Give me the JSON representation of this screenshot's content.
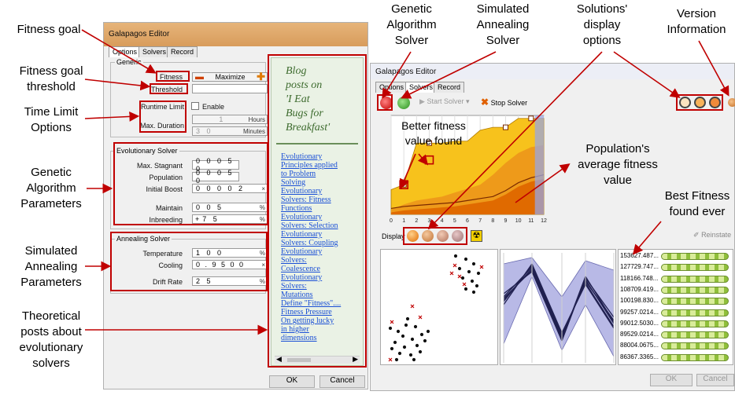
{
  "callouts": {
    "fitness_goal": "Fitness goal",
    "fitness_goal_threshold": [
      "Fitness goal",
      "threshold"
    ],
    "time_limit": [
      "Time Limit",
      "Options"
    ],
    "ga_params": [
      "Genetic",
      "Algorithm",
      "Parameters"
    ],
    "sa_params": [
      "Simulated",
      "Annealing",
      "Parameters"
    ],
    "theory_posts": [
      "Theoretical",
      "posts about",
      "evolutionary",
      "solvers"
    ],
    "ga_solver": [
      "Genetic",
      "Algorithm",
      "Solver"
    ],
    "sa_solver": [
      "Simulated",
      "Annealing",
      "Solver"
    ],
    "display_options": [
      "Solutions'",
      "display",
      "options"
    ],
    "version_info": [
      "Version",
      "Information"
    ],
    "better_fitness": [
      "Better fitness",
      "value found"
    ],
    "population_avg": [
      "Population's",
      "average fitness",
      "value"
    ],
    "best_fitness": [
      "Best Fitness",
      "found ever"
    ]
  },
  "left_editor": {
    "title": "Galapagos Editor",
    "tabs": [
      "Options",
      "Solvers",
      "Record"
    ],
    "generic_group": "Generic",
    "fitness_label": "Fitness",
    "fitness_mode": "Maximize",
    "threshold_label": "Threshold",
    "runtime_limit_label": "Runtime Limit",
    "enable_label": "Enable",
    "hours_value": "1",
    "hours_unit": "Hours",
    "max_duration_label": "Max. Duration",
    "minutes_value": "3 0",
    "minutes_unit": "Minutes",
    "evo_group": "Evolutionary Solver",
    "max_stagnant_label": "Max. Stagnant",
    "max_stagnant_value": "0 0 0 5 0",
    "population_label": "Population",
    "population_value": "0 0 0 5 0",
    "initial_boost_label": "Initial Boost",
    "initial_boost_value": "0 0 0 0 2",
    "initial_boost_unit": "×",
    "maintain_label": "Maintain",
    "maintain_value": "0 0 5",
    "maintain_unit": "%",
    "inbreeding_label": "Inbreeding",
    "inbreeding_sign": "+",
    "inbreeding_value": "7 5",
    "inbreeding_unit": "%",
    "anneal_group": "Annealing Solver",
    "temperature_label": "Temperature",
    "temperature_value": "1 0 0",
    "temperature_unit": "%",
    "cooling_label": "Cooling",
    "cooling_value": "0 . 9 5 0 0",
    "cooling_unit": "×",
    "drift_label": "Drift Rate",
    "drift_value": "2 5",
    "drift_unit": "%",
    "ok": "OK",
    "cancel": "Cancel",
    "blog_title": [
      "Blog",
      "posts on",
      "'I Eat",
      "Bugs for",
      "Breakfast'"
    ],
    "blog_links": [
      "Evolutionary",
      "Principles applied",
      "to Problem",
      "Solving",
      "Evolutionary",
      "Solvers: Fitness",
      "Functions",
      "Evolutionary",
      "Solvers: Selection",
      "Evolutionary",
      "Solvers: Coupling",
      "Evolutionary",
      "Solvers:",
      "Coalescence",
      "Evolutionary",
      "Solvers:",
      "Mutations",
      "Define \"Fitness\"....",
      "Fitness Pressure",
      "On getting lucky",
      "in higher",
      "dimensions"
    ]
  },
  "right_editor": {
    "title": "Galapagos Editor",
    "tabs": [
      "Options",
      "Solvers",
      "Record"
    ],
    "start_solver": "Start Solver",
    "stop_solver": "Stop Solver",
    "display_label": "Display",
    "reinstate": "Reinstate",
    "ok": "OK",
    "cancel": "Cancel",
    "x_ticks": [
      "0",
      "1",
      "2",
      "3",
      "4",
      "5",
      "6",
      "7",
      "8",
      "9",
      "10",
      "11",
      "12"
    ],
    "fitness_values": [
      "153627.487...",
      "127729.747...",
      "118166.748...",
      "108709.419...",
      "100198.830...",
      "99257.0214...",
      "99012.5030...",
      "89529.0214...",
      "88004.0675...",
      "86367.3365..."
    ],
    "colors": {
      "fill": "#f5b800",
      "dark_fill": "#e07800",
      "panel": "#c9cadc"
    }
  },
  "chart_data": {
    "type": "area",
    "title": "",
    "x": [
      0,
      1,
      2,
      3,
      4,
      5,
      6,
      7,
      8,
      9,
      10,
      11,
      12
    ],
    "series": [
      {
        "values": [
          0.25,
          0.3,
          0.72,
          0.72,
          0.72,
          0.74,
          0.74,
          0.85,
          0.88,
          0.88,
          0.97,
          0.97,
          0.97
        ]
      },
      {
        "values": [
          0.05,
          0.1,
          0.14,
          0.16,
          0.18,
          0.22,
          0.26,
          0.3,
          0.4,
          0.52,
          0.62,
          0.68,
          0.7
        ]
      },
      {
        "values": [
          0.02,
          0.04,
          0.05,
          0.06,
          0.07,
          0.08,
          0.1,
          0.12,
          0.14,
          0.2,
          0.28,
          0.33,
          0.36
        ]
      }
    ],
    "xlim": [
      0,
      12
    ],
    "ylim": [
      0,
      1
    ],
    "grid": true
  }
}
